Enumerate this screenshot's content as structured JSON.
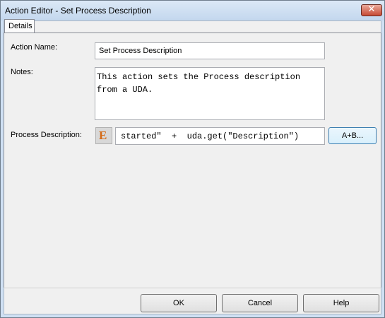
{
  "window": {
    "title": "Action Editor - Set Process Description",
    "close_symbol": "✕"
  },
  "tabs": [
    {
      "label": "Details"
    }
  ],
  "form": {
    "action_name": {
      "label": "Action Name:",
      "value": "Set Process Description"
    },
    "notes": {
      "label": "Notes:",
      "line1": "This action sets the Process description",
      "line2": "from a UDA."
    },
    "process_description": {
      "label": "Process Description:",
      "expression_icon": "E",
      "value": "started\"  +  uda.get(\"Description\")",
      "builder_button": "A+B..."
    }
  },
  "footer": {
    "ok": "OK",
    "cancel": "Cancel",
    "help": "Help"
  },
  "colors": {
    "expression_icon": "#d46a16",
    "close_button": "#c74a34"
  }
}
